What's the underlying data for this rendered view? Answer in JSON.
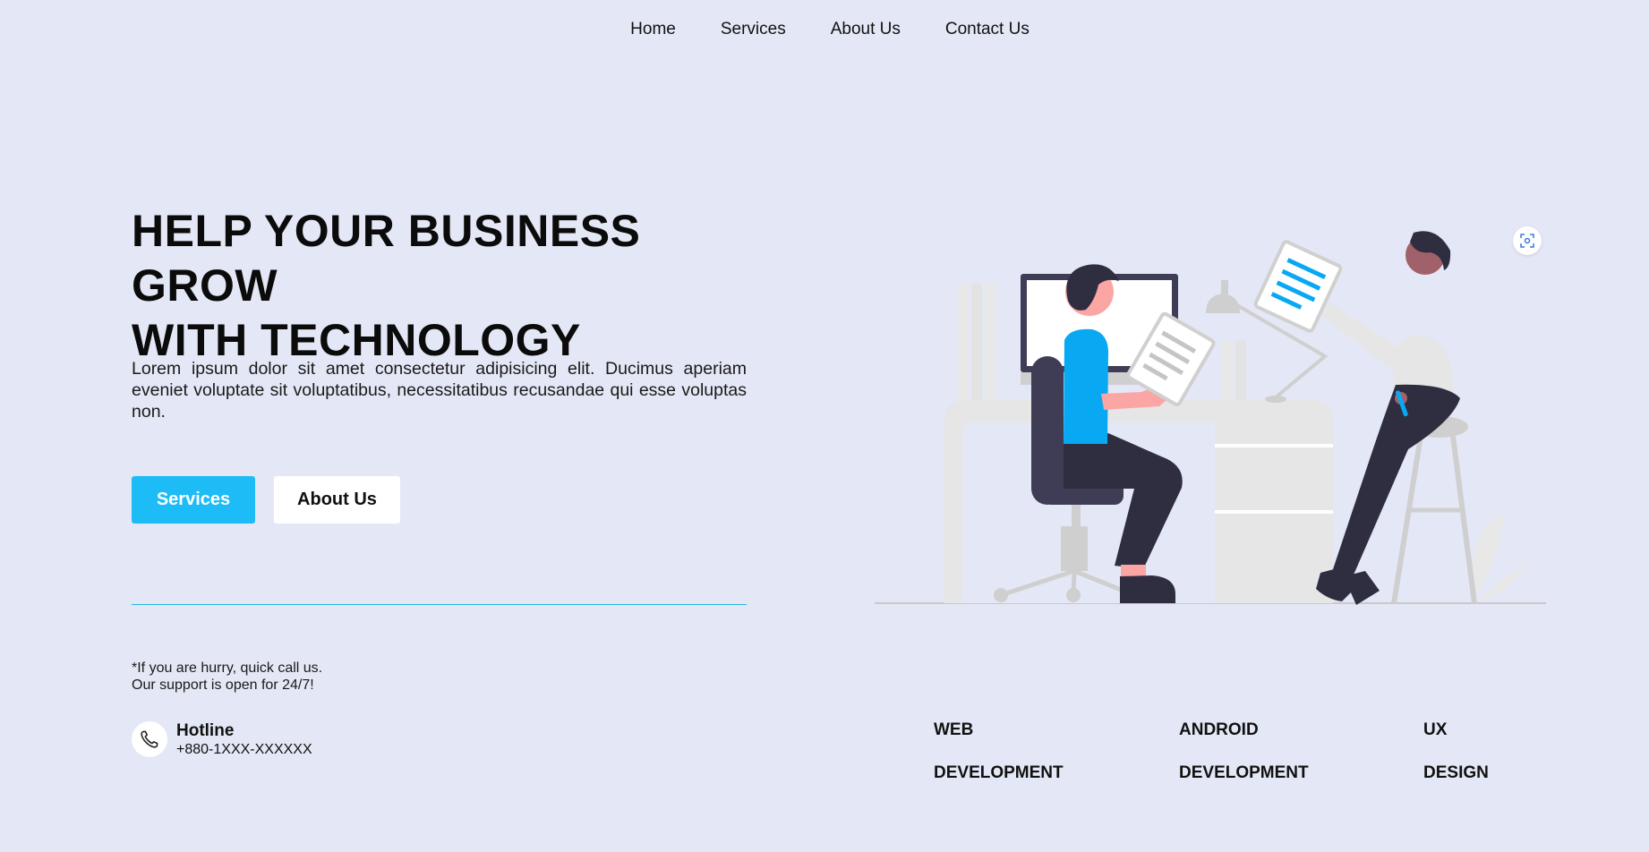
{
  "nav": {
    "items": [
      "Home",
      "Services",
      "About Us",
      "Contact Us"
    ]
  },
  "hero": {
    "title_line1": "HELP YOUR BUSINESS GROW",
    "title_line2": "WITH TECHNOLOGY",
    "description": "Lorem ipsum dolor sit amet consectetur adipisicing elit. Ducimus aperiam eveniet voluptate sit voluptatibus, necessitatibus recusandae qui esse voluptas non.",
    "primary_button": "Services",
    "secondary_button": "About Us"
  },
  "support": {
    "note_line1": "*If you are hurry, quick call us.",
    "note_line2": "Our support is open for 24/7!",
    "hotline_label": "Hotline",
    "hotline_number": "+880-1XXX-XXXXXX",
    "icon": "phone-icon"
  },
  "services": [
    {
      "line1": "WEB",
      "line2": "DEVELOPMENT"
    },
    {
      "line1": "ANDROID",
      "line2": "DEVELOPMENT"
    },
    {
      "line1": "UX",
      "line2": "DESIGN"
    }
  ],
  "colors": {
    "background": "#e4e8f6",
    "accent": "#1ebcf7",
    "divider": "#27b6de",
    "dark_figure": "#2f2e41"
  }
}
